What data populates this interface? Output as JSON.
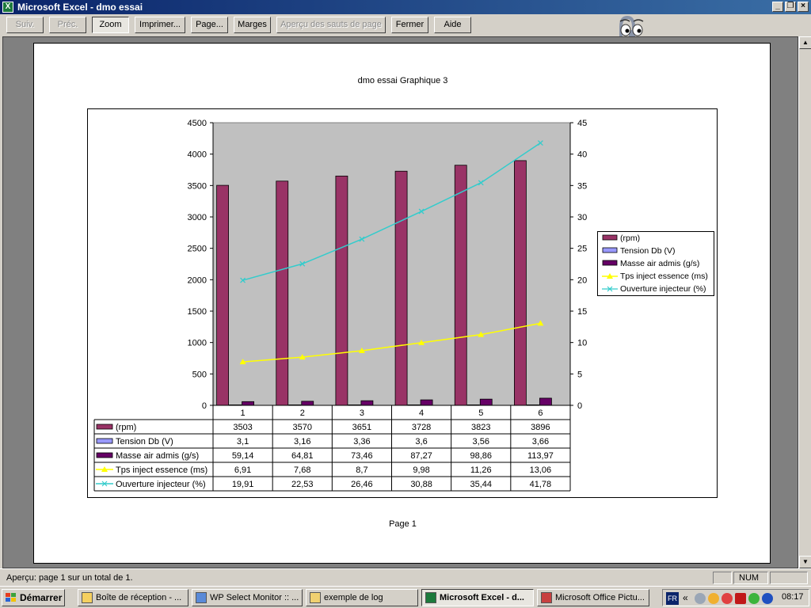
{
  "window": {
    "title": "Microsoft Excel - dmo essai",
    "app_icon": "X",
    "controls": [
      "_",
      "❐",
      "×"
    ]
  },
  "toolbar": {
    "next": "Suiv.",
    "prev": "Préc.",
    "zoom": "Zoom",
    "print": "Imprimer...",
    "page": "Page...",
    "margins": "Marges",
    "page_break": "Aperçu des sauts de page",
    "close": "Fermer",
    "help": "Aide"
  },
  "page": {
    "title": "dmo essai Graphique 3",
    "footer": "Page 1"
  },
  "status": {
    "text": "Aperçu: page 1 sur un total de 1.",
    "num": "NUM"
  },
  "taskbar": {
    "start": "Démarrer",
    "tasks": [
      {
        "label": "Boîte de réception - ...",
        "icon": "inbox-icon"
      },
      {
        "label": "WP Select Monitor :: ...",
        "icon": "browser-icon"
      },
      {
        "label": "exemple de log",
        "icon": "folder-icon"
      },
      {
        "label": "Microsoft Excel - d...",
        "icon": "excel-icon"
      },
      {
        "label": "Microsoft Office Pictu...",
        "icon": "picture-icon"
      }
    ],
    "lang": "FR",
    "tray_chevron": "«",
    "clock": "08:17"
  },
  "colors": {
    "rpm": "#993366",
    "tension": "#9999ff",
    "masse": "#660066",
    "tps": "#ffff00",
    "ouverture": "#33cccc",
    "plot_bg": "#c0c0c0"
  },
  "chart_data": {
    "type": "bar",
    "title": "dmo essai Graphique 3",
    "categories": [
      "1",
      "2",
      "3",
      "4",
      "5",
      "6"
    ],
    "y_left": {
      "min": 0,
      "max": 4500,
      "step": 500
    },
    "y_right": {
      "min": 0,
      "max": 45,
      "step": 5
    },
    "grid": false,
    "legend_position": "right",
    "series": [
      {
        "name": "(rpm)",
        "type": "bar",
        "axis": "left",
        "values": [
          3503,
          3570,
          3651,
          3728,
          3823,
          3896
        ],
        "labels": [
          "3503",
          "3570",
          "3651",
          "3728",
          "3823",
          "3896"
        ]
      },
      {
        "name": "Tension Db (V)",
        "type": "bar",
        "axis": "left",
        "values": [
          3.1,
          3.16,
          3.36,
          3.6,
          3.56,
          3.66
        ],
        "labels": [
          "3,1",
          "3,16",
          "3,36",
          "3,6",
          "3,56",
          "3,66"
        ]
      },
      {
        "name": "Masse air admis (g/s)",
        "type": "bar",
        "axis": "left",
        "values": [
          59.14,
          64.81,
          73.46,
          87.27,
          98.86,
          113.97
        ],
        "labels": [
          "59,14",
          "64,81",
          "73,46",
          "87,27",
          "98,86",
          "113,97"
        ]
      },
      {
        "name": "Tps inject essence (ms)",
        "type": "line",
        "axis": "right",
        "values": [
          6.91,
          7.68,
          8.7,
          9.98,
          11.26,
          13.06
        ],
        "labels": [
          "6,91",
          "7,68",
          "8,7",
          "9,98",
          "11,26",
          "13,06"
        ]
      },
      {
        "name": "Ouverture injecteur (%)",
        "type": "line",
        "axis": "right",
        "values": [
          19.91,
          22.53,
          26.46,
          30.88,
          35.44,
          41.78
        ],
        "labels": [
          "19,91",
          "22,53",
          "26,46",
          "30,88",
          "35,44",
          "41,78"
        ]
      }
    ]
  }
}
